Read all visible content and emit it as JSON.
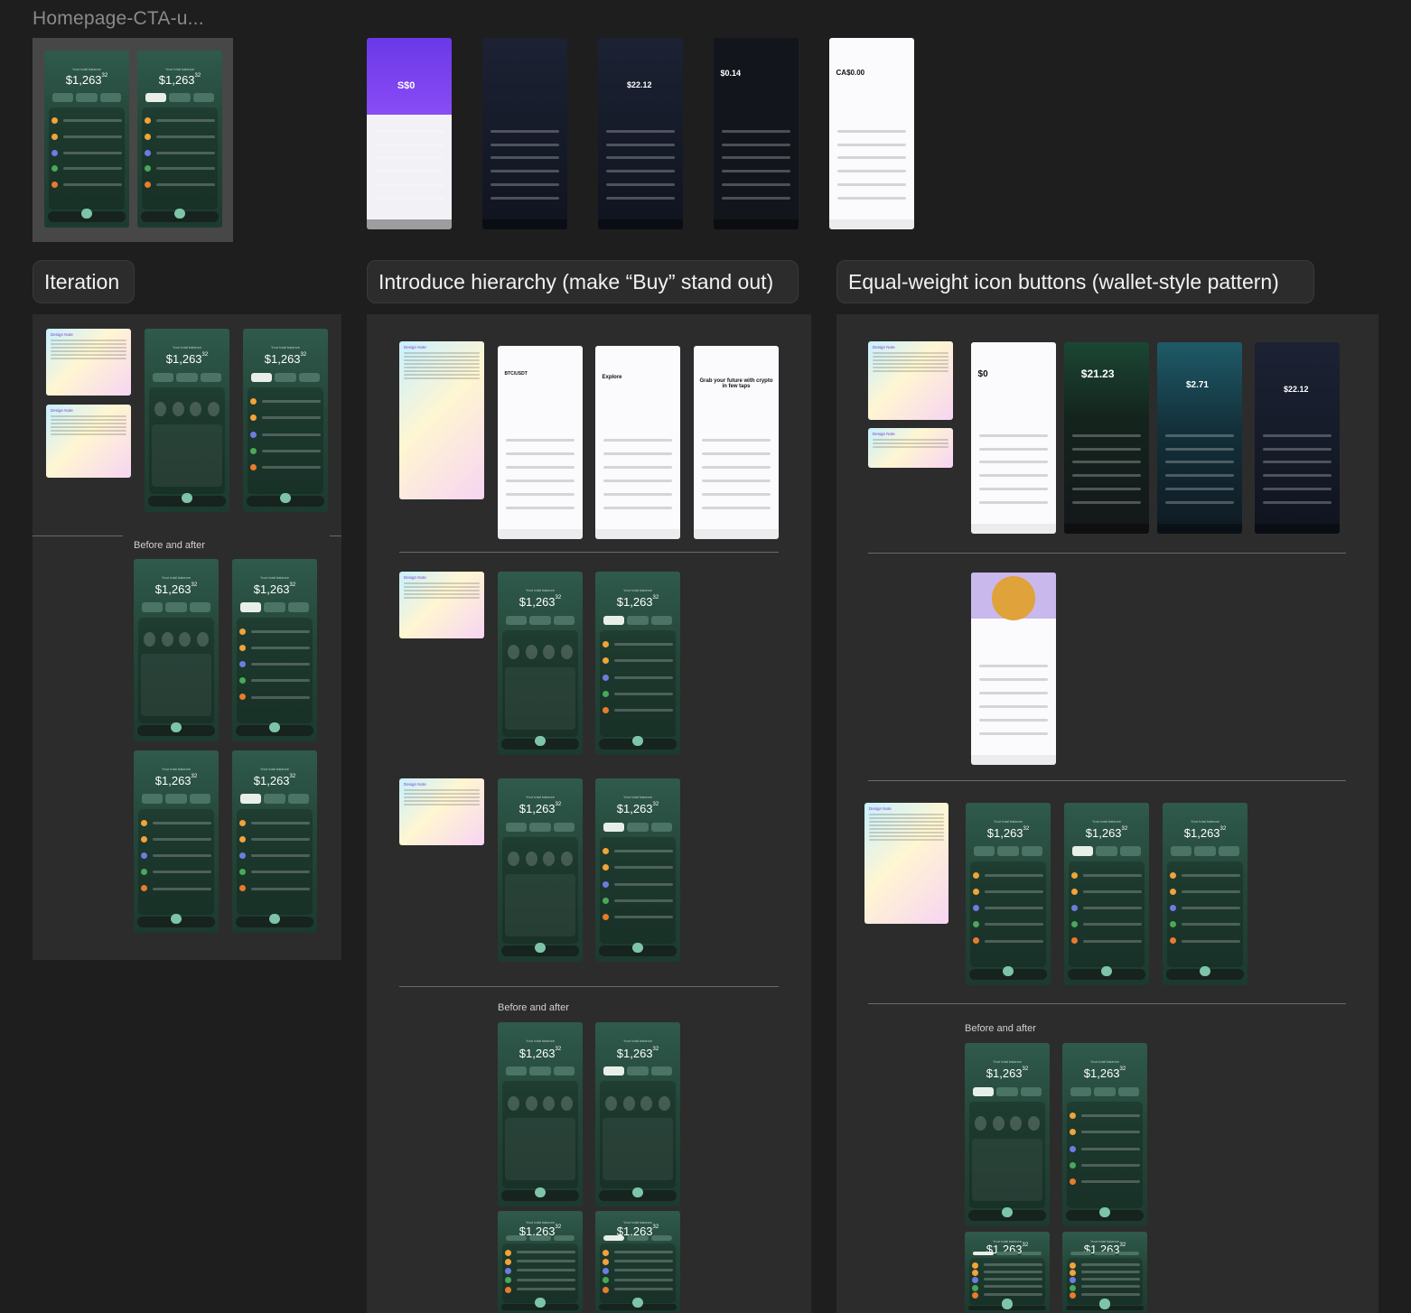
{
  "canvas": {
    "background": "#1e1e1e",
    "panel": "#2c2c2c",
    "highlight": "#d4b02a"
  },
  "frames": {
    "top_title": "Homepage-CTA-u..."
  },
  "sections": [
    {
      "label": "Iteration"
    },
    {
      "label": "Introduce hierarchy (make “Buy” stand out)"
    },
    {
      "label": "Equal-weight icon buttons (wallet-style pattern)"
    }
  ],
  "captions": {
    "iteration_before_after": "Before and after",
    "hierarchy_before_after": "Before and after",
    "equal_before_after": "Before and after"
  },
  "notes": {
    "title": "Design Note"
  },
  "phone_mock": {
    "balance_label": "Your total balance",
    "balance_main": "$1,263",
    "balance_cents": "32"
  },
  "references": {
    "purple_balance": "S$0",
    "coinbase_balance": "CA$0.00",
    "dark_balance_1": "$22.12",
    "black_balance": "$0.14",
    "equal_balance_1": "$0",
    "equal_balance_2": "$21.23",
    "equal_balance_3": "$2.71",
    "equal_balance_4": "$22.12",
    "hierarchy_header": "Grab your future with crypto in few taps",
    "hierarchy_explore": "Explore",
    "hierarchy_pair": "BTC/USDT"
  }
}
